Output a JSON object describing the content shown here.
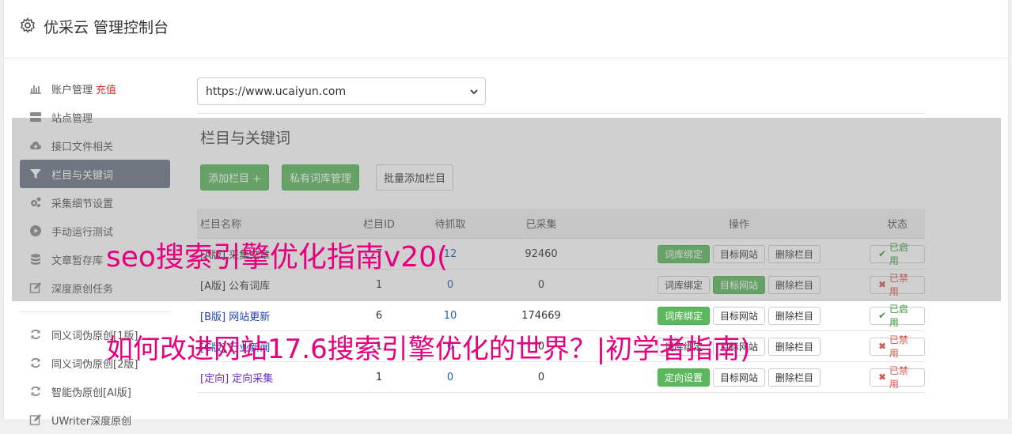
{
  "header": {
    "title": "优采云 管理控制台"
  },
  "sidebar": {
    "items": [
      {
        "label": "账户管理",
        "extra": "充值",
        "icon": "bar-chart-icon"
      },
      {
        "label": "站点管理",
        "icon": "server-icon"
      },
      {
        "label": "接口文件相关",
        "icon": "cloud-upload-icon"
      },
      {
        "label": "栏目与关键词",
        "icon": "filter-icon",
        "active": true
      },
      {
        "label": "采集细节设置",
        "icon": "cogs-icon"
      },
      {
        "label": "手动运行测试",
        "icon": "play-circle-icon"
      },
      {
        "label": "文章暂存库",
        "icon": "database-icon"
      },
      {
        "label": "深度原创任务",
        "icon": "edit-icon"
      }
    ],
    "items2": [
      {
        "label": "同义词伪原创[1版]",
        "icon": "refresh-icon"
      },
      {
        "label": "同义词伪原创[2版]",
        "icon": "refresh-icon"
      },
      {
        "label": "智能伪原创[AI版]",
        "icon": "refresh-icon"
      },
      {
        "label": "UWriter深度原创",
        "icon": "edit-icon"
      }
    ]
  },
  "main": {
    "site_select": "https://www.ucaiyun.com",
    "section_title": "栏目与关键词",
    "buttons": {
      "add_column": "添加栏目 +",
      "private_lexicon": "私有词库管理",
      "batch_add": "批量添加栏目"
    },
    "table": {
      "headers": {
        "name": "栏目名称",
        "id": "栏目ID",
        "pending": "待抓取",
        "done": "已采集",
        "ops": "操作",
        "state": "状态"
      },
      "rows": [
        {
          "prefix": "[A版]",
          "name": "采集文章",
          "id": "7",
          "pending": "12",
          "done": "92460",
          "op1": "词库绑定",
          "op2": "目标网站",
          "op3": "删除栏目",
          "state": "已启用"
        },
        {
          "prefix": "[A版]",
          "name": "公有词库",
          "id": "1",
          "pending": "0",
          "done": "0",
          "op1": "词库绑定",
          "op2": "目标网站",
          "op3": "删除栏目",
          "state": "已禁用"
        },
        {
          "prefix": "[B版]",
          "name": "网站更新",
          "id": "6",
          "pending": "10",
          "done": "174669",
          "op1": "词库绑定",
          "op2": "目标网站",
          "op3": "删除栏目",
          "state": "已启用"
        },
        {
          "prefix": "[C版]",
          "name": "行业新闻",
          "id": "1",
          "pending": "0",
          "done": "0",
          "op1": "词库绑定",
          "op2": "目标网站",
          "op3": "删除栏目",
          "state": "已禁用"
        },
        {
          "prefix": "[定向]",
          "name": "定向采集",
          "id": "1",
          "pending": "0",
          "done": "0",
          "op1": "定向设置",
          "op2": "目标网站",
          "op3": "删除栏目",
          "state": "已禁用"
        }
      ]
    }
  },
  "watermarks": {
    "line1": "seo搜索引擎优化指南v20(",
    "line2": "如何改进网站17.6搜索引擎优化的世界？|初学者指南)"
  },
  "colors": {
    "accent_green": "#5cb85c",
    "active_nav": "#6c7583",
    "watermark": "#e4007f",
    "recharge": "#e03131"
  }
}
